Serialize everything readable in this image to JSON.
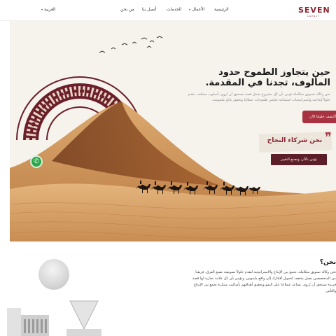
{
  "header": {
    "logo": "SEVEN",
    "logo_sub": "AGENCY",
    "nav": {
      "home": "الرئيسية",
      "works": "الأعمال",
      "services": "الخدمات",
      "contact": "أتصل بنا",
      "about": "من نحن",
      "language": "العربية"
    }
  },
  "hero": {
    "headline": "حين يتجاوز الطموح حدود المألوف، تجدنا في المقدمة.",
    "subtext": "نحن وكالة تسويق متكاملة تؤمن بأن كل مشروع يحمل قصة تستحق أن تُروى بأسلوب مختلف. نقدم حلولاً إبداعية واستراتيجيات استثنائية تعكس طموحات عملائنا وتحقق نتائج ملموسة.",
    "cta_label": "أكتشف حلولنا الآن",
    "partner_title": "نحن شركاء النجاح",
    "partner_badge": "نؤمن بالأثر، ونصنع التغيير",
    "whatsapp_icon": "whatsapp-icon"
  },
  "about": {
    "title": "نحن؟",
    "text": "نحن وكالة تسويق متكاملة، نجمع بين الإبداع والاستراتيجية لنقدم حلولاً تسويقية تصنع الفرق. فريقنا من المتخصصين يعمل بشغف لتحويل أفكارك إلى واقع ملموس، ونؤمن بأن كل علامة تجارية لها قصة فريدة تستحق أن تُروى. نساعد عملاءنا على النمو وتحقيق أهدافهم بأساليب مبتكرة تجمع بين الإبداع والتأثير."
  },
  "colors": {
    "brand": "#8a2431",
    "cta": "#a6333f",
    "badge": "#5c1e28",
    "sand": "#d9a467",
    "whatsapp": "#2ba84a"
  }
}
